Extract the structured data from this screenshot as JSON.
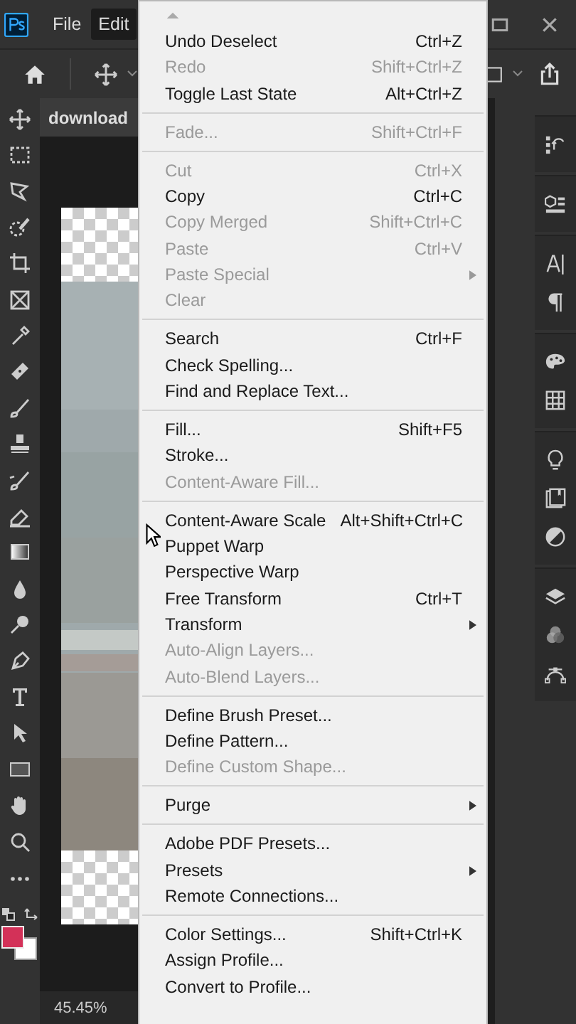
{
  "menubar": [
    {
      "label": "File",
      "selected": false
    },
    {
      "label": "Edit",
      "selected": true
    }
  ],
  "document_tab": {
    "title": "download"
  },
  "status_bar": {
    "zoom": "45.45%"
  },
  "edit_menu": [
    {
      "kind": "scroll-up"
    },
    {
      "kind": "item",
      "label": "Undo Deselect",
      "shortcut": "Ctrl+Z",
      "disabled": false,
      "submenu": false
    },
    {
      "kind": "item",
      "label": "Redo",
      "shortcut": "Shift+Ctrl+Z",
      "disabled": true,
      "submenu": false
    },
    {
      "kind": "item",
      "label": "Toggle Last State",
      "shortcut": "Alt+Ctrl+Z",
      "disabled": false,
      "submenu": false
    },
    {
      "kind": "separator"
    },
    {
      "kind": "item",
      "label": "Fade...",
      "shortcut": "Shift+Ctrl+F",
      "disabled": true,
      "submenu": false
    },
    {
      "kind": "separator"
    },
    {
      "kind": "item",
      "label": "Cut",
      "shortcut": "Ctrl+X",
      "disabled": true,
      "submenu": false
    },
    {
      "kind": "item",
      "label": "Copy",
      "shortcut": "Ctrl+C",
      "disabled": false,
      "submenu": false
    },
    {
      "kind": "item",
      "label": "Copy Merged",
      "shortcut": "Shift+Ctrl+C",
      "disabled": true,
      "submenu": false
    },
    {
      "kind": "item",
      "label": "Paste",
      "shortcut": "Ctrl+V",
      "disabled": true,
      "submenu": false
    },
    {
      "kind": "item",
      "label": "Paste Special",
      "disabled": true,
      "submenu": true
    },
    {
      "kind": "item",
      "label": "Clear",
      "disabled": true,
      "submenu": false
    },
    {
      "kind": "separator"
    },
    {
      "kind": "item",
      "label": "Search",
      "shortcut": "Ctrl+F",
      "disabled": false,
      "submenu": false
    },
    {
      "kind": "item",
      "label": "Check Spelling...",
      "disabled": false,
      "submenu": false
    },
    {
      "kind": "item",
      "label": "Find and Replace Text...",
      "disabled": false,
      "submenu": false
    },
    {
      "kind": "separator"
    },
    {
      "kind": "item",
      "label": "Fill...",
      "shortcut": "Shift+F5",
      "disabled": false,
      "submenu": false
    },
    {
      "kind": "item",
      "label": "Stroke...",
      "disabled": false,
      "submenu": false
    },
    {
      "kind": "item",
      "label": "Content-Aware Fill...",
      "disabled": true,
      "submenu": false
    },
    {
      "kind": "separator"
    },
    {
      "kind": "item",
      "label": "Content-Aware Scale",
      "shortcut": "Alt+Shift+Ctrl+C",
      "disabled": false,
      "submenu": false
    },
    {
      "kind": "item",
      "label": "Puppet Warp",
      "disabled": false,
      "submenu": false
    },
    {
      "kind": "item",
      "label": "Perspective Warp",
      "disabled": false,
      "submenu": false
    },
    {
      "kind": "item",
      "label": "Free Transform",
      "shortcut": "Ctrl+T",
      "disabled": false,
      "submenu": false
    },
    {
      "kind": "item",
      "label": "Transform",
      "disabled": false,
      "submenu": true
    },
    {
      "kind": "item",
      "label": "Auto-Align Layers...",
      "disabled": true,
      "submenu": false
    },
    {
      "kind": "item",
      "label": "Auto-Blend Layers...",
      "disabled": true,
      "submenu": false
    },
    {
      "kind": "separator"
    },
    {
      "kind": "item",
      "label": "Define Brush Preset...",
      "disabled": false,
      "submenu": false
    },
    {
      "kind": "item",
      "label": "Define Pattern...",
      "disabled": false,
      "submenu": false
    },
    {
      "kind": "item",
      "label": "Define Custom Shape...",
      "disabled": true,
      "submenu": false
    },
    {
      "kind": "separator"
    },
    {
      "kind": "item",
      "label": "Purge",
      "disabled": false,
      "submenu": true
    },
    {
      "kind": "separator"
    },
    {
      "kind": "item",
      "label": "Adobe PDF Presets...",
      "disabled": false,
      "submenu": false
    },
    {
      "kind": "item",
      "label": "Presets",
      "disabled": false,
      "submenu": true
    },
    {
      "kind": "item",
      "label": "Remote Connections...",
      "disabled": false,
      "submenu": false
    },
    {
      "kind": "separator"
    },
    {
      "kind": "item",
      "label": "Color Settings...",
      "shortcut": "Shift+Ctrl+K",
      "disabled": false,
      "submenu": false
    },
    {
      "kind": "item",
      "label": "Assign Profile...",
      "disabled": false,
      "submenu": false
    },
    {
      "kind": "item",
      "label": "Convert to Profile...",
      "disabled": false,
      "submenu": false
    }
  ]
}
